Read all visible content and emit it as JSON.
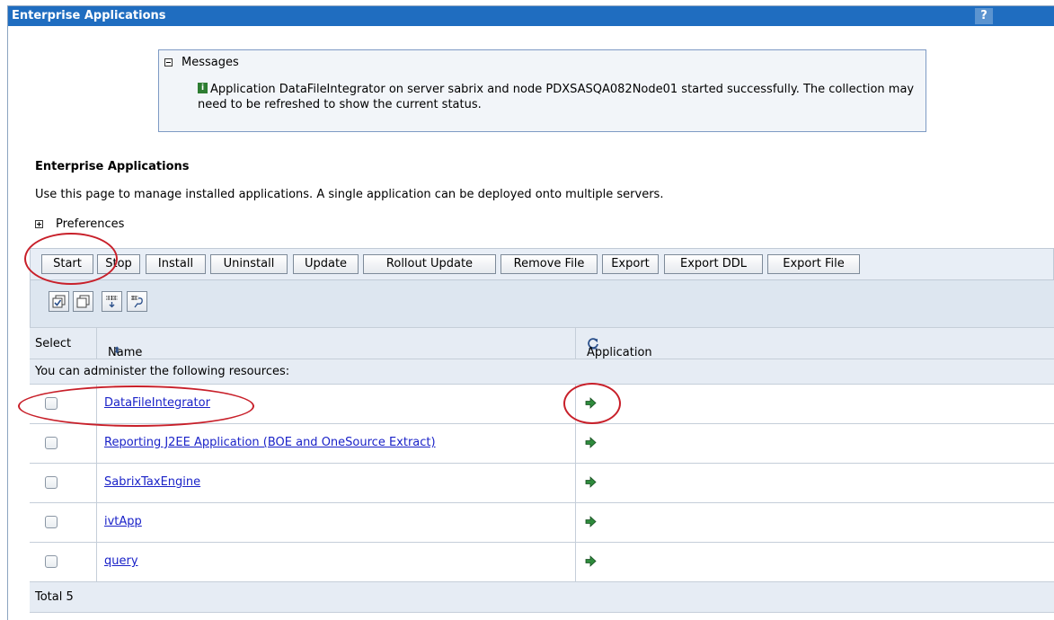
{
  "window": {
    "title": "Enterprise Applications",
    "help": "?"
  },
  "messages": {
    "header": "Messages",
    "text": "Application DataFileIntegrator on server sabrix and node PDXSASQA082Node01 started successfully. The collection may need to be refreshed to show the current status.",
    "icon_letter": "i"
  },
  "section": {
    "title": "Enterprise Applications",
    "description": "Use this page to manage installed applications. A single application can be deployed onto multiple servers.",
    "preferences": "Preferences"
  },
  "toolbar": {
    "buttons": [
      "Start",
      "Stop",
      "Install",
      "Uninstall",
      "Update",
      "Rollout Update",
      "Remove File",
      "Export",
      "Export DDL",
      "Export File"
    ]
  },
  "icon_toolbar": [
    "select-all-icon",
    "deselect-all-icon",
    "show-filter-icon",
    "clear-filter-icon"
  ],
  "table": {
    "headers": {
      "select": "Select",
      "name": "Name",
      "status": "Application Status"
    },
    "subheader": "You can administer the following resources:",
    "rows": [
      {
        "name": "DataFileIntegrator",
        "status": "started"
      },
      {
        "name": "Reporting J2EE Application (BOE and OneSource Extract)",
        "status": "started"
      },
      {
        "name": "SabrixTaxEngine",
        "status": "started"
      },
      {
        "name": "ivtApp",
        "status": "started"
      },
      {
        "name": "query",
        "status": "started"
      }
    ],
    "total": "Total 5"
  },
  "colors": {
    "title_bar": "#1f6dc0",
    "link": "#1a22c8",
    "annotation": "#c8202a",
    "status_started": "#2e8b3c"
  }
}
